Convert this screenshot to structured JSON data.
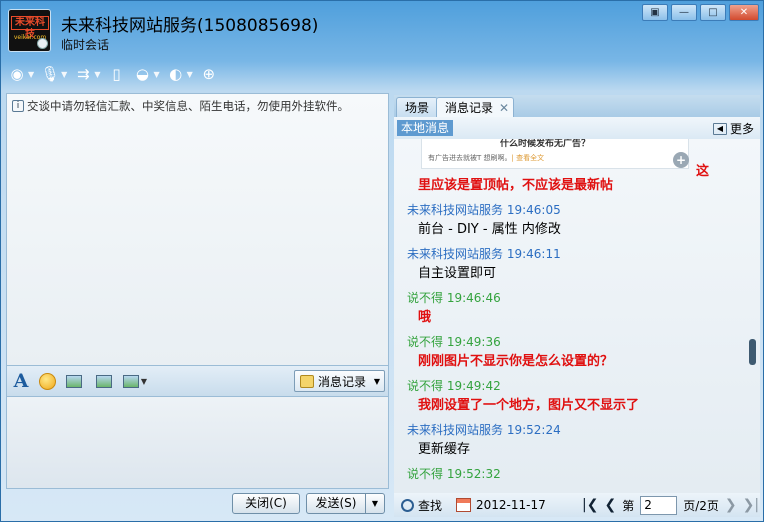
{
  "window": {
    "title": "未来科技网站服务(1508085698)",
    "subtitle": "临时会话",
    "controls": [
      "▣",
      "—",
      "□",
      "✕"
    ]
  },
  "avatar": {
    "logo_text": "未来科技",
    "site_text": "veikai.com"
  },
  "toolbar": [
    {
      "icon": "webcam-icon",
      "glyph": "◉"
    },
    {
      "icon": "microphone-icon",
      "glyph": "🎙"
    },
    {
      "icon": "file-transfer-icon",
      "glyph": "⇉"
    },
    {
      "icon": "phone-icon",
      "glyph": "▯"
    },
    {
      "icon": "remote-assist-icon",
      "glyph": "◒"
    },
    {
      "icon": "contact-card-icon",
      "glyph": "◐"
    },
    {
      "icon": "add-contact-icon",
      "glyph": "⊕"
    }
  ],
  "warning": "交谈中请勿轻信汇款、中奖信息、陌生电话，勿使用外挂软件。",
  "format_bar": {
    "font_glyph": "A",
    "history_label": "消息记录"
  },
  "buttons": {
    "close": "关闭(C)",
    "send": "发送(S)"
  },
  "right_panel": {
    "tabs": [
      "场景",
      "消息记录"
    ],
    "local_tag": "本地消息",
    "more": "更多"
  },
  "log": {
    "thumb_title": "什么时候发布无广告？",
    "thumb_text": "有广告进去就被T 想刷啊。",
    "thumb_link": "| 查看全文",
    "tail": "这",
    "entries": [
      {
        "type": "msg",
        "red": true,
        "text": "里应该是置顶帖，不应该是最新帖"
      },
      {
        "type": "sender",
        "who": "svc",
        "text": "未来科技网站服务 19:46:05"
      },
      {
        "type": "msg",
        "red": false,
        "text": "前台 - DIY - 属性 内修改"
      },
      {
        "type": "sender",
        "who": "svc",
        "text": "未来科技网站服务 19:46:11"
      },
      {
        "type": "msg",
        "red": false,
        "text": "自主设置即可"
      },
      {
        "type": "sender",
        "who": "me",
        "text": "说不得 19:46:46"
      },
      {
        "type": "msg",
        "red": true,
        "text": "哦"
      },
      {
        "type": "sender",
        "who": "me",
        "text": "说不得 19:49:36"
      },
      {
        "type": "msg",
        "red": true,
        "text": "刚刚图片不显示你是怎么设置的？"
      },
      {
        "type": "sender",
        "who": "me",
        "text": "说不得 19:49:42"
      },
      {
        "type": "msg",
        "red": true,
        "text": "我刚设置了一个地方，图片又不显示了"
      },
      {
        "type": "sender",
        "who": "svc",
        "text": "未来科技网站服务 19:52:24"
      },
      {
        "type": "msg",
        "red": false,
        "text": "更新缓存"
      },
      {
        "type": "sender",
        "who": "me",
        "text": "说不得 19:52:32"
      }
    ]
  },
  "footer": {
    "search": "查找",
    "date": "2012-11-17",
    "page_prefix": "第",
    "page_value": "2",
    "page_suffix": "页/2页"
  }
}
